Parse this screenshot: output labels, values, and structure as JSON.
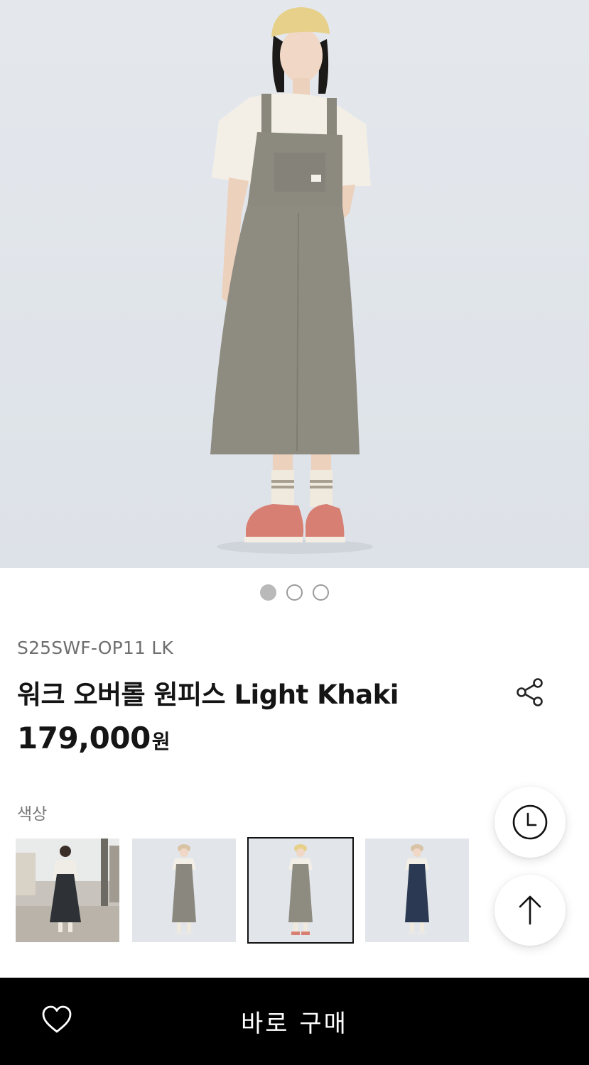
{
  "product": {
    "sku": "S25SWF-OP11 LK",
    "title": "워크 오버롤 원피스 Light Khaki",
    "price_amount": "179,000",
    "price_unit": "원"
  },
  "gallery": {
    "image_count": 3,
    "active_index": 0,
    "hero_icon": "product-photo"
  },
  "color_section": {
    "label": "색상",
    "options": [
      {
        "name": "lookbook",
        "selected": false
      },
      {
        "name": "gray",
        "selected": false
      },
      {
        "name": "light-khaki",
        "selected": true
      },
      {
        "name": "navy",
        "selected": false
      }
    ]
  },
  "floating_buttons": {
    "recent_icon": "clock-icon",
    "top_icon": "arrow-up-icon"
  },
  "bottom_bar": {
    "wishlist_icon": "heart-icon",
    "buy_label": "바로 구매"
  },
  "colors": {
    "background": "#ffffff",
    "bottom_bar": "#000000",
    "text_primary": "#151515",
    "text_secondary": "#6f6f6f"
  }
}
